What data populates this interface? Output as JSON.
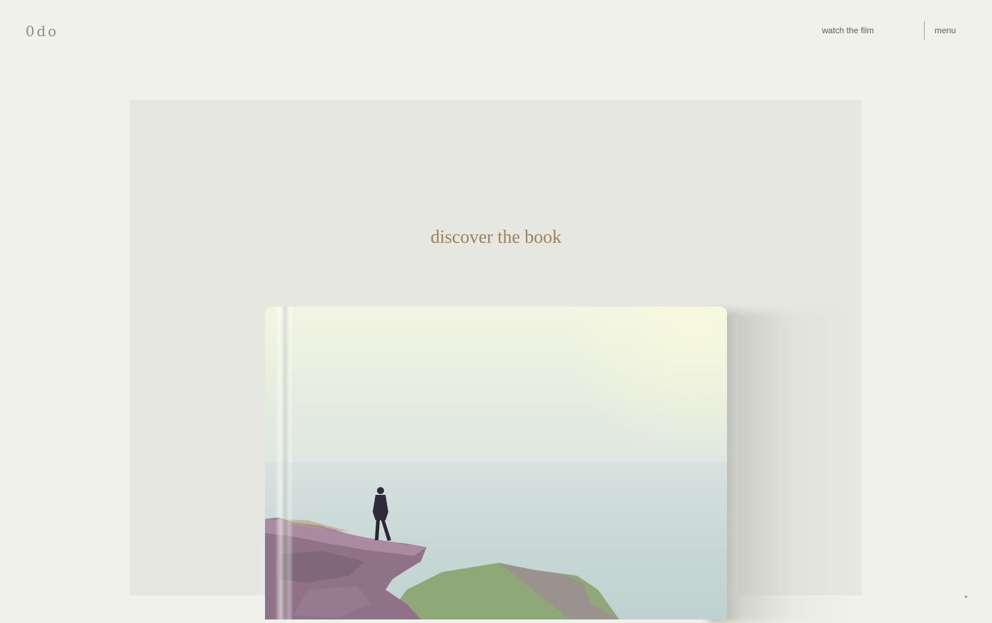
{
  "header": {
    "logo": "0do",
    "nav": {
      "watch_film": "watch the film",
      "menu": "menu"
    }
  },
  "main": {
    "heading": "discover the book",
    "book_cover_alt": "person standing on a sea cliff",
    "scroll_indicator": "▸"
  },
  "colors": {
    "background": "#eff1ea",
    "panel": "#e6e7e1",
    "heading": "#9c8258"
  }
}
